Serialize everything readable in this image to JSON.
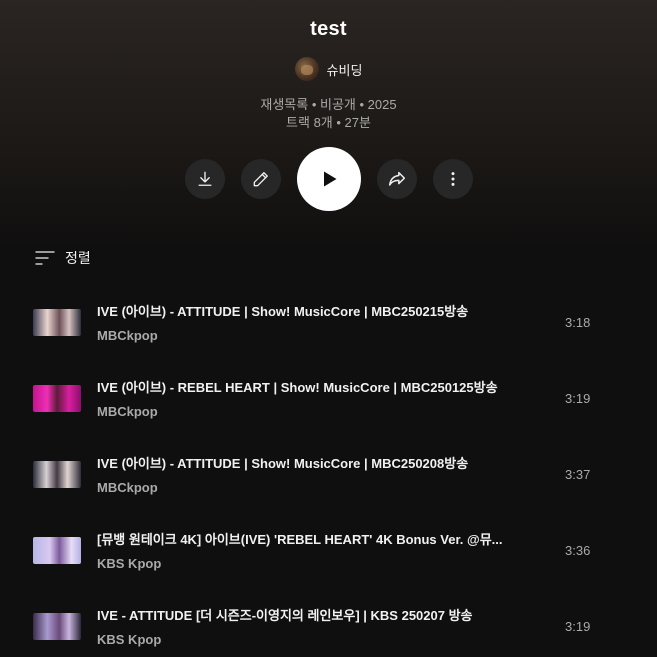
{
  "playlist": {
    "title": "test",
    "owner": "슈비딩",
    "meta_line1": "재생목록 • 비공개 • 2025",
    "meta_line2": "트랙 8개 • 27분"
  },
  "actions": {
    "download_icon": "download-icon",
    "edit_icon": "pencil-icon",
    "play_icon": "play-icon",
    "share_icon": "share-icon",
    "more_icon": "more-vertical-icon"
  },
  "sort": {
    "label": "정렬",
    "icon": "sort-icon"
  },
  "tracks": [
    {
      "title": "IVE (아이브) - ATTITUDE | Show! MusicCore | MBC250215방송",
      "channel": "MBCkpop",
      "duration": "3:18"
    },
    {
      "title": "IVE (아이브) - REBEL HEART | Show! MusicCore | MBC250125방송",
      "channel": "MBCkpop",
      "duration": "3:19"
    },
    {
      "title": "IVE (아이브) - ATTITUDE | Show! MusicCore | MBC250208방송",
      "channel": "MBCkpop",
      "duration": "3:37"
    },
    {
      "title": "[뮤뱅 원테이크 4K] 아이브(IVE) 'REBEL HEART' 4K Bonus Ver. @뮤...",
      "channel": "KBS Kpop",
      "duration": "3:36"
    },
    {
      "title": "IVE - ATTITUDE [더 시즌즈-이영지의 레인보우] | KBS 250207 방송",
      "channel": "KBS Kpop",
      "duration": "3:19"
    }
  ],
  "colors": {
    "background": "#0f0f0f",
    "header_gradient_top": "#2a2522",
    "button_bg": "#272727",
    "text_primary": "#f1f1f1",
    "text_secondary": "#aaaaaa"
  }
}
